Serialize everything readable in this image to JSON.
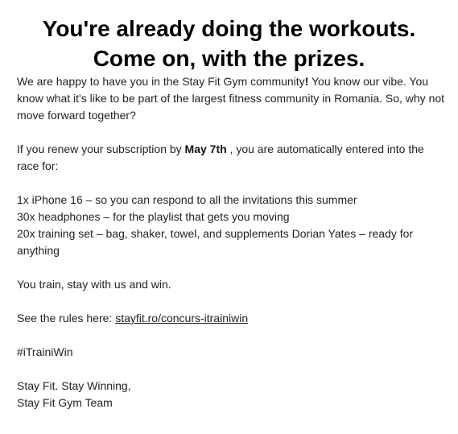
{
  "headline": {
    "line1": "You're already doing the workouts.",
    "line2": "Come on, with the prizes."
  },
  "intro": {
    "part1": "We are happy to have you in the Stay Fit Gym community",
    "excl": "!",
    "part2": " You know our vibe. You know what it's like to be part of the largest fitness community in Romania. So, why not move forward together?"
  },
  "renew": {
    "before": "If you renew your subscription by ",
    "date": "May 7th",
    "after": " , you are automatically entered into the race for:"
  },
  "prizes": [
    "1x iPhone 16 – so you can respond to all the invitations this summer",
    "30x headphones – for the playlist that gets you moving",
    "20x training set – bag, shaker, towel, and supplements Dorian Yates – ready for anything"
  ],
  "cta": "You train, stay with us and win.",
  "rules": {
    "label": "See the rules here: ",
    "link_text": "stayfit.ro/concurs-itrainiwin"
  },
  "hashtag": "#iTrainiWin",
  "signoff": {
    "line1": "Stay Fit. Stay Winning,",
    "line2": "Stay Fit Gym Team"
  }
}
